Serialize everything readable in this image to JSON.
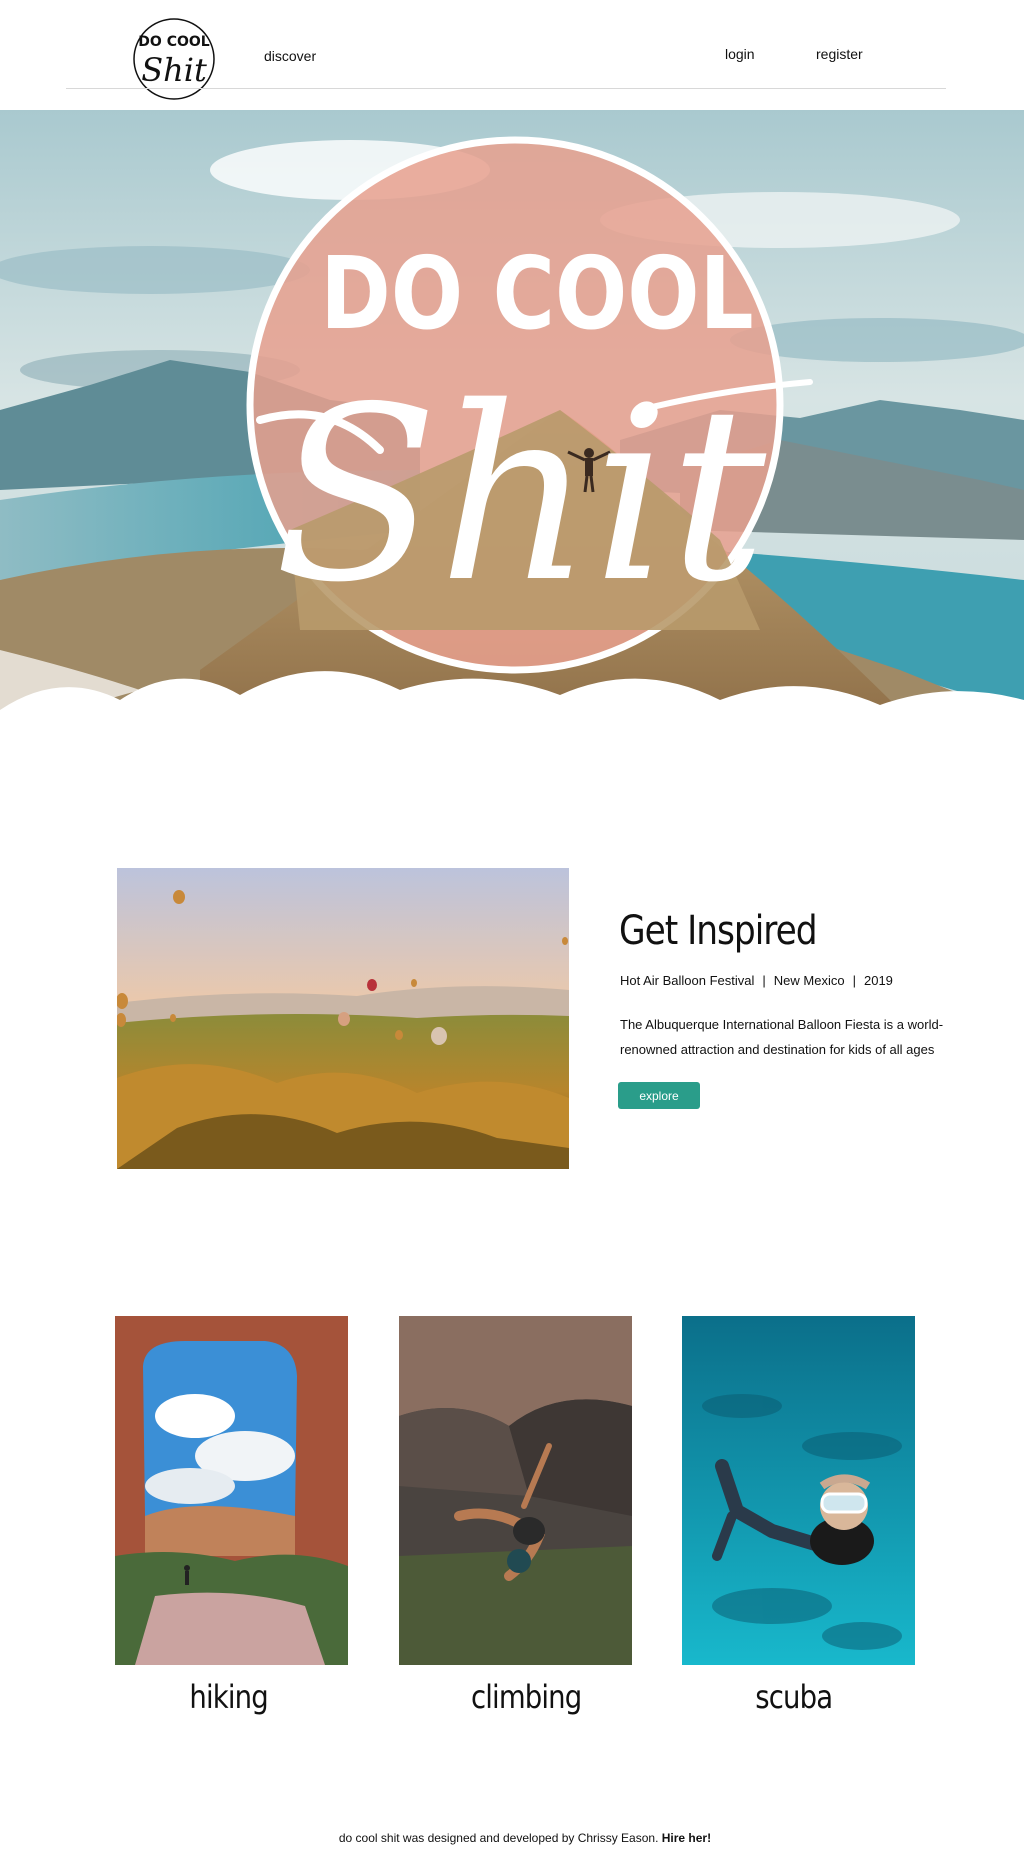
{
  "nav": {
    "logo_line1": "DO COOL",
    "logo_line2": "Shit",
    "discover": "discover",
    "login": "login",
    "register": "register"
  },
  "hero": {
    "title_top": "DO COOL",
    "title_script": "Shit"
  },
  "feature": {
    "title": "Get Inspired",
    "event": "Hot Air Balloon Festival",
    "location": "New Mexico",
    "year": "2019",
    "separator": "|",
    "description": "The Albuquerque International Balloon Fiesta is a world-renowned attraction and destination for kids of all ages",
    "button": "explore"
  },
  "activities": [
    {
      "label": "hiking"
    },
    {
      "label": "climbing"
    },
    {
      "label": "scuba"
    }
  ],
  "footer": {
    "text": "do cool shit was designed and developed by Chrissy Eason.",
    "link": "Hire her!"
  },
  "colors": {
    "accent": "#2a9d8a",
    "hero_circle": "#e8a08e",
    "text": "#111111"
  }
}
